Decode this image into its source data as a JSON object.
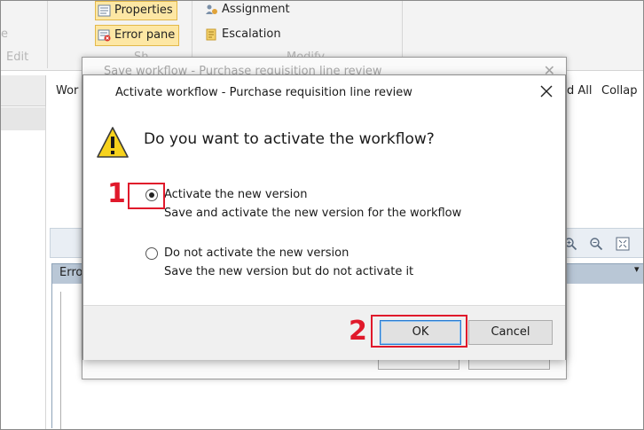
{
  "ribbon": {
    "properties_label": "Properties",
    "error_pane_label": "Error pane",
    "assignment_label": "Assignment",
    "escalation_label": "Escalation",
    "edit_group_label": "Edit",
    "show_group_partial": "Sh",
    "modify_group_partial": "Modify"
  },
  "background": {
    "tab_partial": "Wor",
    "expand_all_partial": "d All",
    "collapse_partial": "Collap",
    "error_column_partial": "Erro"
  },
  "ghost_dialog": {
    "title": "Save workflow - Purchase requisition line review"
  },
  "dialog": {
    "title": "Activate workflow - Purchase requisition line review",
    "question": "Do you want to activate the workflow?",
    "options": [
      {
        "label": "Activate the new version",
        "description": "Save and activate the new version for the workflow",
        "selected": true
      },
      {
        "label": "Do not activate the new version",
        "description": "Save the new version but do not activate it",
        "selected": false
      }
    ],
    "ok_label": "OK",
    "cancel_label": "Cancel"
  },
  "annotations": {
    "step1": "1",
    "step2": "2",
    "color": "#e0192b"
  },
  "icons": [
    "properties-icon",
    "error-pane-icon",
    "assignment-icon",
    "escalation-icon",
    "warning-icon",
    "close-icon",
    "zoom-in-icon",
    "zoom-out-icon",
    "fit-to-window-icon"
  ]
}
